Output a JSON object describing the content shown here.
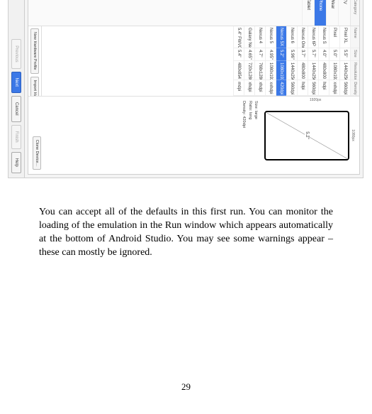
{
  "categories": {
    "header": "Category",
    "items": [
      "TV",
      "Wear",
      "Phone",
      "Tablet"
    ],
    "selected_index": 2
  },
  "table": {
    "headers": {
      "name": "Name",
      "size": "Size",
      "resolution": "Resolution",
      "density": "Density"
    },
    "rows": [
      {
        "name": "Pixel XL",
        "size": "5.5\"",
        "res": "1440x2560",
        "den": "560dpi"
      },
      {
        "name": "Pixel",
        "size": "5.0\"",
        "res": "1080x1920",
        "den": "xxhdpi"
      },
      {
        "name": "Nexus S",
        "size": "4.0\"",
        "res": "480x800",
        "den": "hdpi"
      },
      {
        "name": "Nexus 6P",
        "size": "5.7\"",
        "res": "1440x2560",
        "den": "560dpi"
      },
      {
        "name": "Nexus One",
        "size": "3.7\"",
        "res": "480x800",
        "den": "hdpi"
      },
      {
        "name": "Nexus 6",
        "size": "5.96\"",
        "res": "1440x2560",
        "den": "560dpi"
      },
      {
        "name": "Nexus 5X",
        "size": "5.2\"",
        "res": "1080x1920",
        "den": "420dpi"
      },
      {
        "name": "Nexus 5",
        "size": "4.95\"",
        "res": "1080x1920",
        "den": "xxhdpi"
      },
      {
        "name": "Nexus 4",
        "size": "4.7\"",
        "res": "768x1280",
        "den": "xhdpi"
      },
      {
        "name": "Galaxy Nexus",
        "size": "4.65\"",
        "res": "720x1280",
        "den": "xhdpi"
      },
      {
        "name": "5.4\" FWVGA",
        "size": "5.4\"",
        "res": "480x854",
        "den": "mdpi"
      }
    ],
    "selected_index": 6,
    "new_profile_btn": "New Hardware Profile",
    "import_profile_btn": "Import Hardware Profiles"
  },
  "preview": {
    "width_label": "1080px",
    "height_label": "1920px",
    "diagonal": "5.2\"",
    "spec_size_label": "Size:",
    "spec_size_value": "large",
    "spec_ratio_label": "Ratio:",
    "spec_ratio_value": "long",
    "spec_density_label": "Density:",
    "spec_density_value": "420dpi",
    "clone_btn": "Clone Device..."
  },
  "wizard": {
    "previous": "Previous",
    "next": "Next",
    "cancel": "Cancel",
    "finish": "Finish",
    "help": "Help"
  },
  "body_text": "You can accept all of the defaults in this first run. You can monitor the loading of the emulation in the Run window which appears automatically at the bottom of Android Studio. You may see some warnings appear – these can mostly be ignored.",
  "page_number": "29"
}
